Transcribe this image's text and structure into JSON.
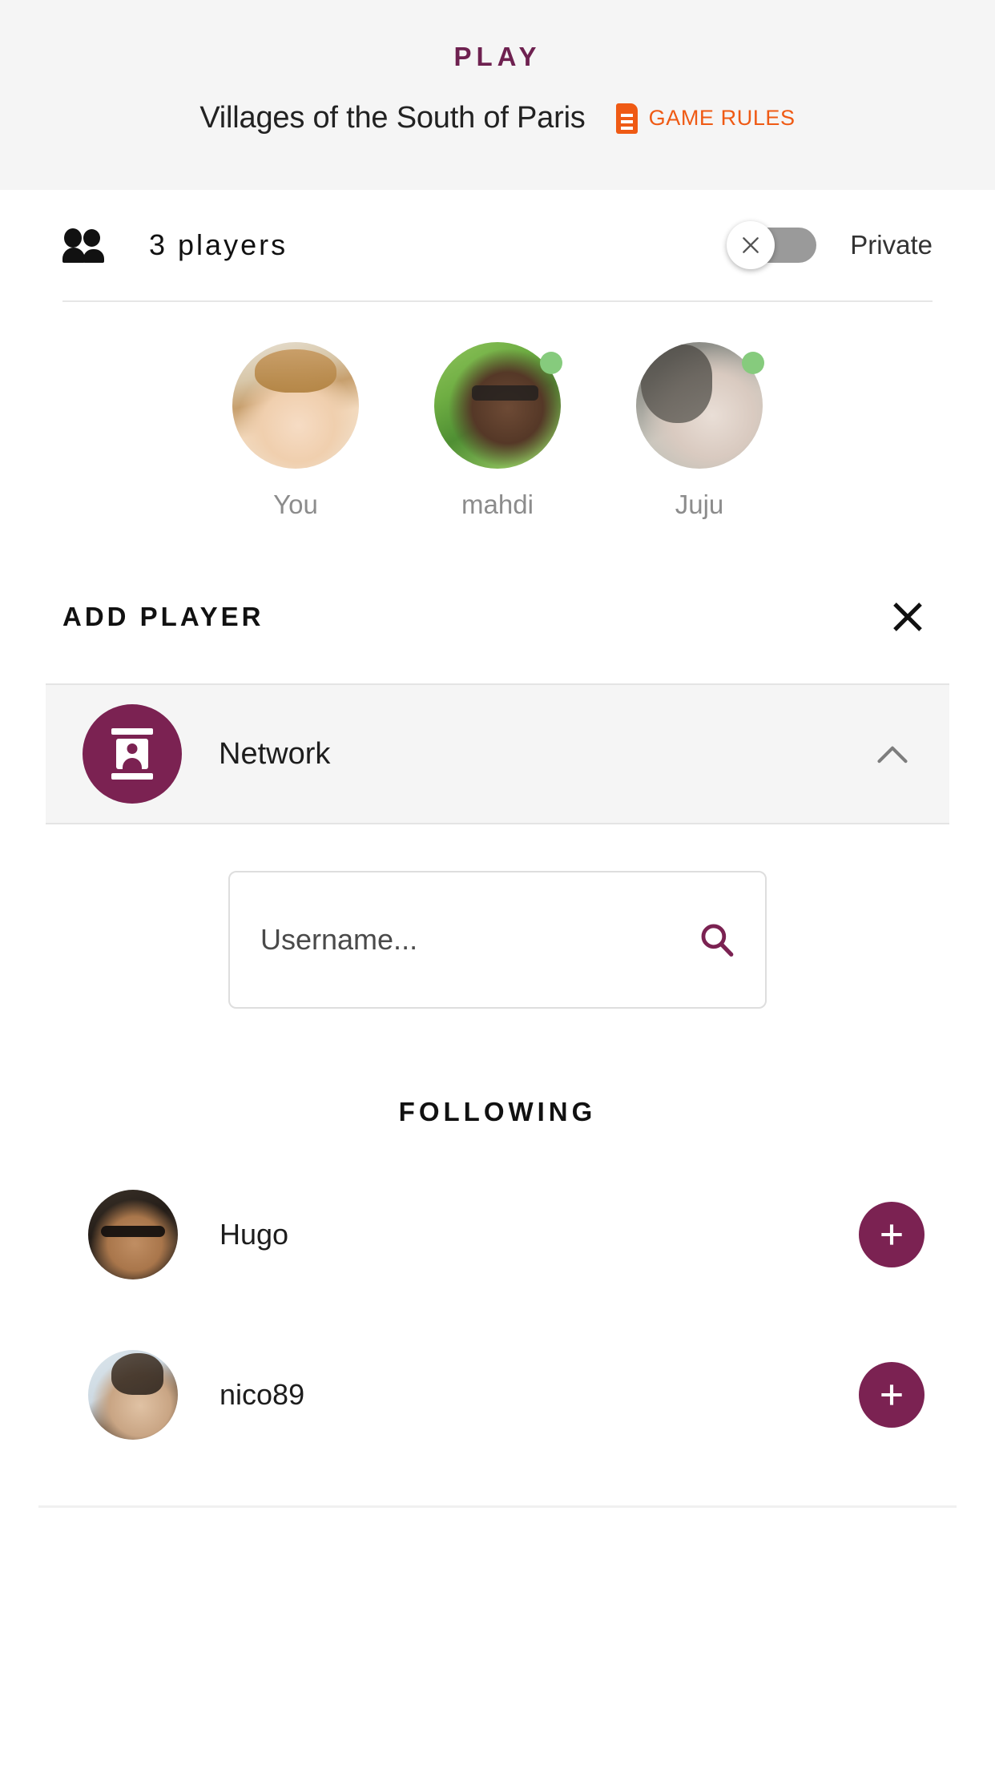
{
  "header": {
    "title": "PLAY",
    "game_name": "Villages of the South of Paris",
    "rules_label": "GAME RULES",
    "rules_icon": "document-icon",
    "accent_color": "#6e2150",
    "rules_color": "#ef5a14",
    "background": "#f5f5f5"
  },
  "players_bar": {
    "icon": "group-people-icon",
    "count_label": "3 players",
    "privacy_label": "Private",
    "toggle_state": "off",
    "toggle_icon": "close-x-icon",
    "toggle_track_color": "#9a9a9a"
  },
  "players": [
    {
      "name": "You",
      "avatar": "avatar-you",
      "online": false,
      "status_color": "#86cb7d"
    },
    {
      "name": "mahdi",
      "avatar": "avatar-mahdi",
      "online": true,
      "status_color": "#86cb7d"
    },
    {
      "name": "Juju",
      "avatar": "avatar-juju",
      "online": true,
      "status_color": "#86cb7d"
    }
  ],
  "add_player": {
    "title": "ADD PLAYER",
    "close_icon": "close-x-icon"
  },
  "network_section": {
    "label": "Network",
    "icon": "contact-card-icon",
    "expanded": true,
    "chevron_icon": "chevron-up-icon",
    "accent_color": "#7b2252",
    "row_background": "#f5f5f5"
  },
  "search": {
    "placeholder": "Username...",
    "value": "",
    "icon": "search-icon",
    "icon_color": "#7b2252"
  },
  "following": {
    "title": "FOLLOWING",
    "items": [
      {
        "name": "Hugo",
        "avatar": "avatar-hugo",
        "action_icon": "plus-icon",
        "action_color": "#7b2252"
      },
      {
        "name": "nico89",
        "avatar": "avatar-nico",
        "action_icon": "plus-icon",
        "action_color": "#7b2252"
      }
    ]
  }
}
